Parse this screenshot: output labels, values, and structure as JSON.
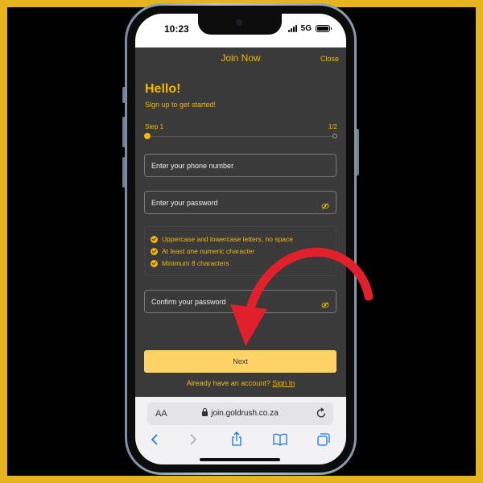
{
  "status": {
    "time": "10:23",
    "network": "5G"
  },
  "header": {
    "title": "Join Now",
    "close_label": "Close"
  },
  "greeting": {
    "title": "Hello!",
    "subtitle": "Sign up to get started!"
  },
  "progress": {
    "step_label": "Step 1",
    "step_count": "1/2",
    "current": 1,
    "total": 2
  },
  "form": {
    "phone_placeholder": "Enter your phone number",
    "password_placeholder": "Enter your password",
    "confirm_placeholder": "Confirm your password"
  },
  "rules": [
    "Uppercase and lowercase letters, no space",
    "At least one numeric character",
    "Minimum 8 characters"
  ],
  "next_label": "Next",
  "signin": {
    "prompt": "Already have an account?",
    "link": "Sign In"
  },
  "browser": {
    "aa_label": "AA",
    "url": "join.goldrush.co.za"
  },
  "colors": {
    "accent": "#f2b705",
    "button": "#ffd366",
    "background": "#3a3a3a",
    "frame": "#e6b41f",
    "arrow": "#e0202a"
  }
}
